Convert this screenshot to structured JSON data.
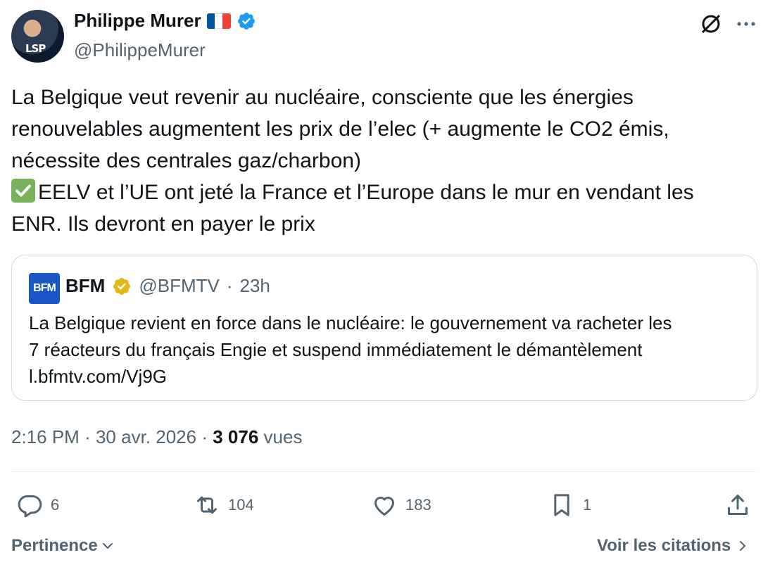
{
  "author": {
    "name": "Philippe Murer",
    "handle": "@PhilippeMurer",
    "avatar_text": "LSP",
    "flag_colors": [
      "#0055a4",
      "#ffffff",
      "#ef4135"
    ],
    "verified_color": "#1d9bf0"
  },
  "tweet": {
    "lines": [
      "La Belgique veut revenir au nucléaire, consciente que les énergies",
      "renouvelables augmentent les prix de l’elec (+ augmente le CO2 émis,",
      "nécessite des centrales gaz/charbon)",
      "EELV et l’UE ont jeté la France et l’Europe dans le mur en vendant les",
      "ENR. Ils devront en payer le prix"
    ]
  },
  "quote": {
    "logo_text": "BFM",
    "name": "BFM",
    "handle": "@BFMTV",
    "time": "23h",
    "separator": "·",
    "lines": [
      "La Belgique revient en force dans le nucléaire: le gouvernement va racheter les",
      "7 réacteurs du français Engie et suspend immédiatement le démantèlement",
      "l.bfmtv.com/Vj9G"
    ],
    "verified_color": "#e2b719"
  },
  "meta": {
    "time": "2:16 PM",
    "separator": "·",
    "date": "30 avr. 2026",
    "views_count": "3 076",
    "views_label": "vues"
  },
  "actions": {
    "replies": "6",
    "reposts": "104",
    "likes": "183",
    "bookmarks": "1"
  },
  "footer": {
    "sort_label": "Pertinence",
    "quotes_label": "Voir les citations"
  }
}
